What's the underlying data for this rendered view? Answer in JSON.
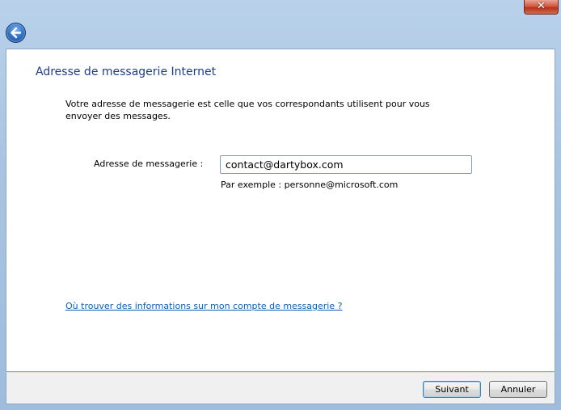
{
  "titlebar": {
    "close_label": "✕",
    "back_icon": "back-arrow-icon"
  },
  "page": {
    "title": "Adresse de messagerie Internet",
    "description": "Votre adresse de messagerie est celle que vos correspondants utilisent pour vous envoyer des messages.",
    "email_label": "Adresse de messagerie :",
    "email_value": "contact@dartybox.com",
    "example": "Par exemple : personne@microsoft.com",
    "help_link": "Où trouver des informations sur mon compte de messagerie ?"
  },
  "footer": {
    "next_label": "Suivant",
    "cancel_label": "Annuler"
  }
}
